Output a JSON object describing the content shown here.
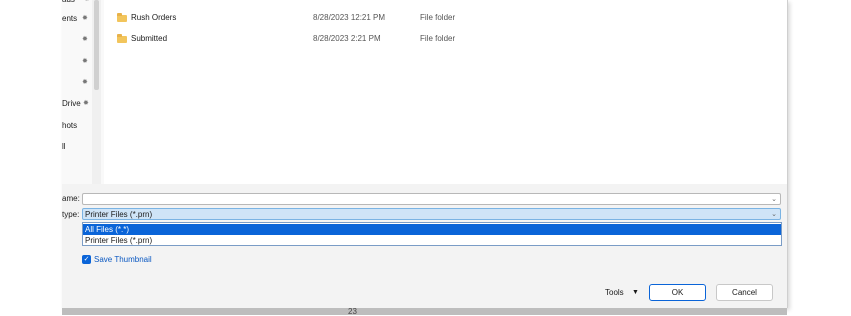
{
  "nav": {
    "items": [
      {
        "label": "ads",
        "pinned": true
      },
      {
        "label": "ents",
        "pinned": true
      },
      {
        "label": "",
        "pinned": true
      },
      {
        "label": "",
        "pinned": true
      },
      {
        "label": "",
        "pinned": true
      },
      {
        "label": "Drive",
        "pinned": true
      },
      {
        "label": "hots",
        "pinned": false
      },
      {
        "label": "ll",
        "pinned": false
      }
    ]
  },
  "files": [
    {
      "name": "Rush Orders",
      "date": "8/28/2023 12:21 PM",
      "type": "File folder"
    },
    {
      "name": "Submitted",
      "date": "8/28/2023 2:21 PM",
      "type": "File folder"
    }
  ],
  "form": {
    "name_label": "ame:",
    "name_value": "",
    "type_label": "type:",
    "type_value": "Printer Files (*.prn)",
    "type_options": [
      "All Files (*.*)",
      "Printer Files (*.prn)"
    ],
    "save_thumbnail_label": "Save Thumbnail",
    "save_thumbnail_checked": true
  },
  "footer": {
    "tools_label": "Tools",
    "ok_label": "OK",
    "cancel_label": "Cancel"
  },
  "background": {
    "page_number": "23"
  },
  "colors": {
    "accent": "#0a64d8",
    "folder": "#f2c55c",
    "selected_field": "#cfe4f7"
  }
}
